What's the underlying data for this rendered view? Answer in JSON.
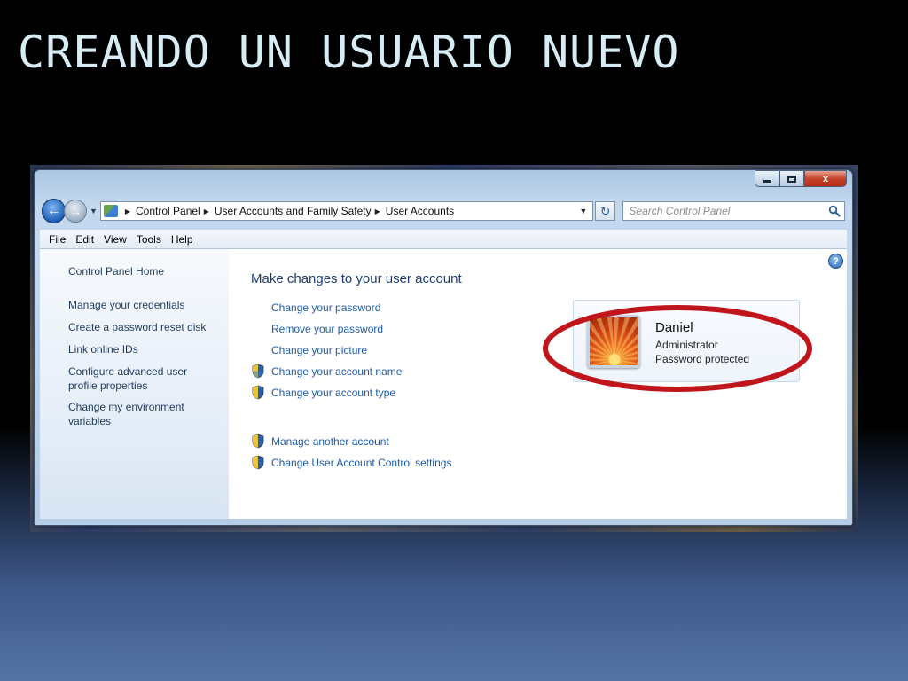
{
  "slide": {
    "title": "CREANDO UN USUARIO NUEVO"
  },
  "window": {
    "caption_buttons": {
      "close_label": "x"
    },
    "address_bar": {
      "crumbs": [
        "Control Panel",
        "User Accounts and Family Safety",
        "User Accounts"
      ]
    },
    "search": {
      "placeholder": "Search Control Panel"
    },
    "menu": [
      "File",
      "Edit",
      "View",
      "Tools",
      "Help"
    ]
  },
  "left_pane": {
    "home": "Control Panel Home",
    "links": [
      "Manage your credentials",
      "Create a password reset disk",
      "Link online IDs",
      "Configure advanced user profile properties",
      "Change my environment variables"
    ]
  },
  "main": {
    "heading": "Make changes to your user account",
    "tasks": [
      "Change your password",
      "Remove your password",
      "Change your picture",
      "Change your account name",
      "Change your account type"
    ],
    "other_tasks": [
      "Manage another account",
      "Change User Account Control settings"
    ],
    "help_label": "?"
  },
  "account": {
    "name": "Daniel",
    "role": "Administrator",
    "status": "Password protected"
  },
  "colors": {
    "annotation_ellipse": "#c0151a",
    "link": "#1f5ba6",
    "heading": "#1e3e73"
  },
  "icons": [
    "back-arrow-icon",
    "forward-arrow-icon",
    "control-panel-icon",
    "refresh-icon",
    "search-icon",
    "help-icon",
    "uac-shield-icon",
    "flower-avatar-icon"
  ]
}
